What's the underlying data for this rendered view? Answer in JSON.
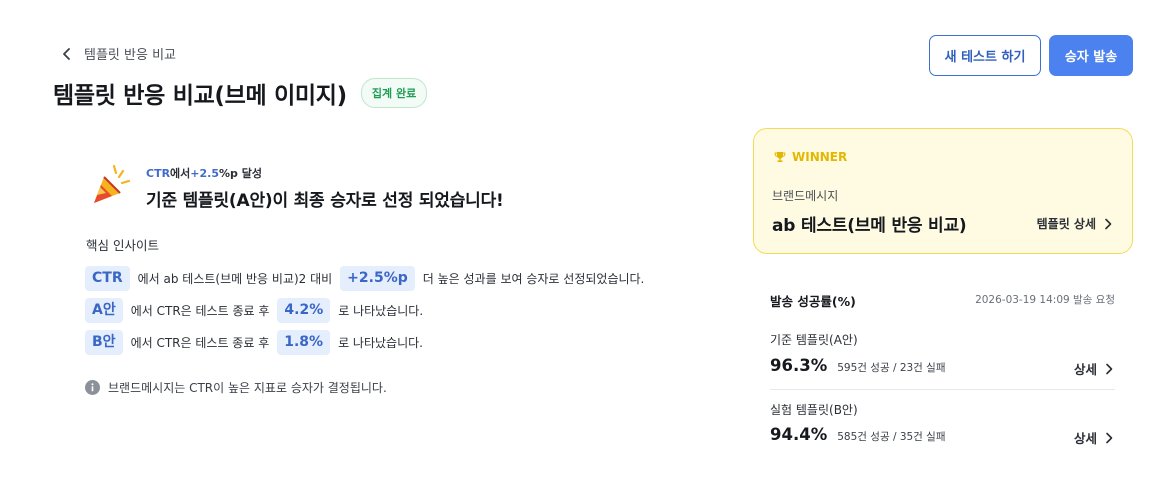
{
  "header": {
    "breadcrumb": "템플릿 반응 비교",
    "title": "템플릿 반응 비교(브메 이미지)",
    "status_badge": "집계 완료",
    "new_test_button": "새 테스트 하기",
    "send_winner_button": "승자 발송"
  },
  "announcement": {
    "metric": "CTR",
    "metric_suffix": "에서",
    "lift": "+2.5",
    "lift_suffix": "%p 달성",
    "headline": "기준 템플릿(A안)이 최종 승자로 선정 되었습니다!"
  },
  "insights": {
    "heading": "핵심 인사이트",
    "rows": [
      {
        "chip": "CTR",
        "text1": "에서 ab 테스트(브메 반응 비교)2 대비",
        "chip2": "+2.5%p",
        "text2": "더 높은 성과를 보여 승자로 선정되었습니다."
      },
      {
        "chip": "A안",
        "text1": "에서 CTR은 테스트 종료 후",
        "chip2": "4.2%",
        "text2": "로 나타났습니다."
      },
      {
        "chip": "B안",
        "text1": "에서 CTR은 테스트 종료 후",
        "chip2": "1.8%",
        "text2": "로 나타났습니다."
      }
    ],
    "note": "브랜드메시지는 CTR이 높은 지표로 승자가 결정됩니다."
  },
  "winner": {
    "tag": "WINNER",
    "subtitle": "브랜드메시지",
    "name": "ab 테스트(브메 반응 비교)",
    "link": "템플릿 상세",
    "accent_color": "#e3b700"
  },
  "send_rate": {
    "title": "발송 성공률(%)",
    "timestamp": "2026-03-19 14:09 발송 요청",
    "templates": [
      {
        "name": "기준 템플릿(A안)",
        "pct": "96.3%",
        "counts": "595건 성공 / 23건 실패",
        "link": "상세"
      },
      {
        "name": "실험 템플릿(B안)",
        "pct": "94.4%",
        "counts": "585건 성공 / 35건 실패",
        "link": "상세"
      }
    ]
  },
  "colors": {
    "primary": "#4b82f0",
    "chip_bg": "#e5eefc",
    "success": "#1f9d55",
    "winner_bg": "#fffbe2"
  }
}
